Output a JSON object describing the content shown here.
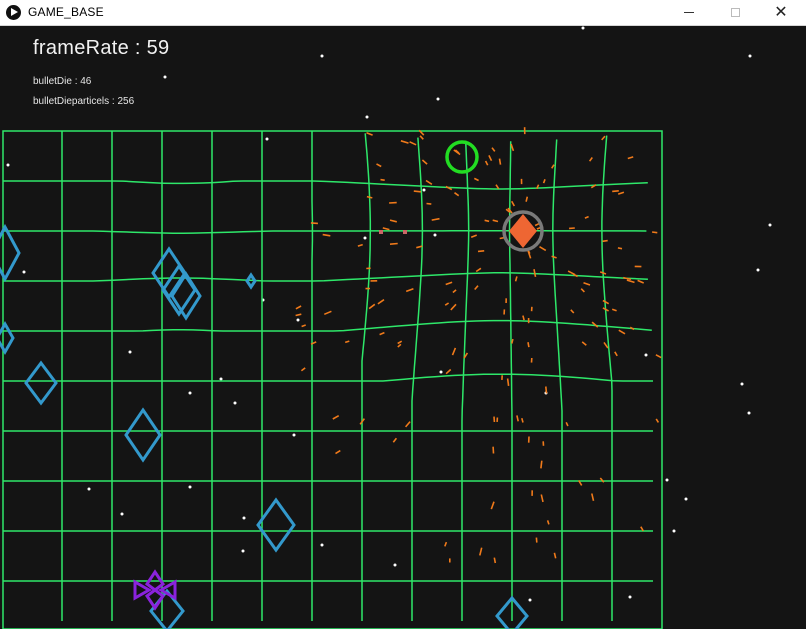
{
  "window": {
    "title": "GAME_BASE",
    "minimize_icon": "minimize-icon",
    "maximize_icon": "maximize-icon",
    "close_icon": "close-icon",
    "close_glyph": "✕"
  },
  "hud": {
    "frame_rate": "frameRate : 59",
    "bullet_die": "bulletDie : 46",
    "bullet_die_particles": "bulletDieparticels : 256"
  },
  "colors": {
    "background": "#141414",
    "grid": "#2ee86a",
    "enemy_diamond": "#3399cc",
    "player_ring": "#7a7a7a",
    "player": "#ee6633",
    "particles": "#f07a1a",
    "target_ring": "#22dd22",
    "boss": "#8a22dd",
    "stars": "#ffffff"
  }
}
